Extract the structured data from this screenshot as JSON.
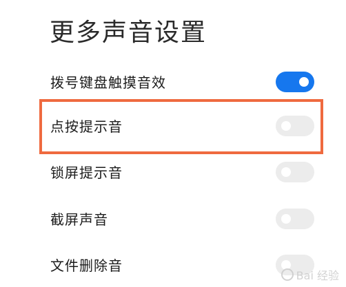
{
  "header": {
    "title": "更多声音设置"
  },
  "settings": [
    {
      "label": "拨号键盘触摸音效",
      "enabled": true
    },
    {
      "label": "点按提示音",
      "enabled": false
    },
    {
      "label": "锁屏提示音",
      "enabled": false
    },
    {
      "label": "截屏声音",
      "enabled": false
    },
    {
      "label": "文件删除音",
      "enabled": false
    }
  ],
  "watermark": {
    "text": "Bai 经验",
    "icon": "paw-icon"
  },
  "colors": {
    "toggle_on": "#1677ee",
    "toggle_off": "#ececec",
    "highlight": "#ef6a3f"
  }
}
